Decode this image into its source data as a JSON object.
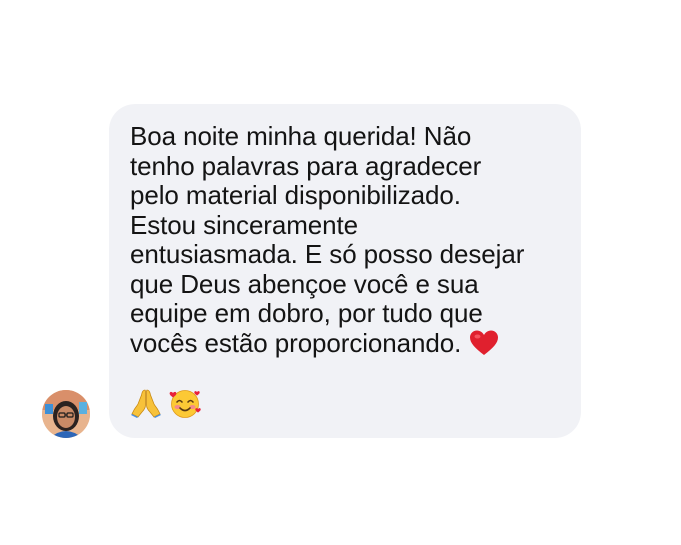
{
  "message": {
    "lines": [
      "Boa noite minha querida! Não",
      "tenho palavras para agradecer",
      "pelo material disponibilizado.",
      "Estou sinceramente",
      "entusiasmada. E só posso desejar",
      "que Deus abençoe você e sua",
      "equipe em dobro, por tudo que",
      "vocês estão proporcionando."
    ],
    "emojis": [
      "red-heart-icon",
      "folded-hands-icon",
      "smiling-face-with-hearts-icon"
    ]
  },
  "colors": {
    "bubble_background": "#f1f2f6",
    "text": "#141414",
    "heart": "#e0202e"
  }
}
